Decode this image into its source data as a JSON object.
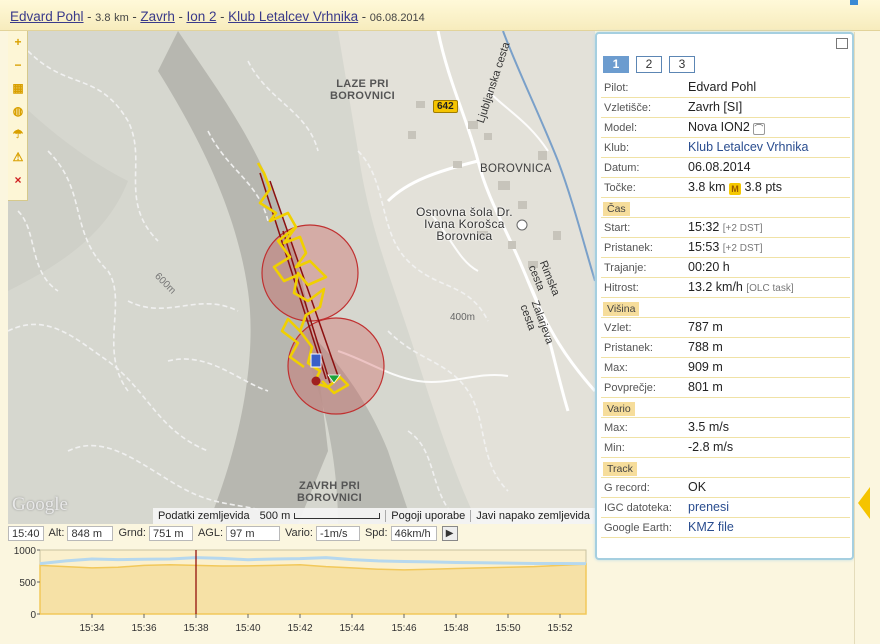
{
  "header": {
    "pilot": "Edvard Pohl",
    "distance": "3.8",
    "distance_unit": "km",
    "site": "Zavrh",
    "glider": "Ion 2",
    "club": "Klub Letalcev Vrhnika",
    "date": "06.08.2014",
    "separator": "-"
  },
  "map": {
    "toolbar": [
      {
        "icon": "zoom-in-icon",
        "glyph": "+"
      },
      {
        "icon": "zoom-out-icon",
        "glyph": "−"
      },
      {
        "icon": "map-type-icon",
        "glyph": "▦"
      },
      {
        "icon": "layers-icon",
        "glyph": "◍"
      },
      {
        "icon": "paraglider-icon",
        "glyph": "☂"
      },
      {
        "icon": "warning-icon",
        "glyph": "⚠"
      },
      {
        "icon": "close-icon",
        "glyph": "×"
      }
    ],
    "labels": {
      "laze": "LAZE PRI\nBOROVNICI",
      "borovnica": "BOROVNICA",
      "school": "Osnovna šola Dr.\nIvana Korošca\nBorovnica",
      "zavrh": "ZAVRH PRI\nBOROVNICI",
      "road_642": "642",
      "ljubljanska": "Ljubljanska cesta",
      "rimska": "Rimska cesta",
      "zalarjeva": "Zalarjeva cesta",
      "contour_400": "400m",
      "contour_600": "600m",
      "google": "Google"
    },
    "footer": {
      "map_data": "Podatki zemljevida",
      "scale": "500 m",
      "terms": "Pogoji uporabe",
      "report": "Javi napako zemljevida"
    }
  },
  "readout": {
    "time": "15:40",
    "alt_label": "Alt:",
    "alt": "848 m",
    "grnd_label": "Grnd:",
    "grnd": "751 m",
    "agl_label": "AGL:",
    "agl": "97 m",
    "vario_label": "Vario:",
    "vario": "-1m/s",
    "spd_label": "Spd:",
    "spd": "46km/h",
    "play_icon": "play-icon"
  },
  "chart_data": {
    "type": "area",
    "title": "",
    "xlabel": "",
    "ylabel": "",
    "ylim": [
      0,
      1000
    ],
    "y_ticks": [
      "1000",
      "500",
      "0"
    ],
    "x_ticks": [
      "15:34",
      "15:36",
      "15:38",
      "15:40",
      "15:42",
      "15:44",
      "15:46",
      "15:48",
      "15:50",
      "15:52"
    ],
    "x": [
      "15:32",
      "15:33",
      "15:34",
      "15:35",
      "15:36",
      "15:37",
      "15:38",
      "15:39",
      "15:40",
      "15:41",
      "15:42",
      "15:43",
      "15:44",
      "15:45",
      "15:46",
      "15:47",
      "15:48",
      "15:49",
      "15:50",
      "15:51",
      "15:52",
      "15:53"
    ],
    "series": [
      {
        "values": [
          787,
          830,
          860,
          850,
          855,
          860,
          880,
          870,
          848,
          860,
          865,
          880,
          850,
          830,
          820,
          815,
          805,
          800,
          795,
          790,
          789,
          788
        ]
      },
      {
        "values": [
          760,
          740,
          720,
          730,
          760,
          770,
          760,
          750,
          751,
          760,
          770,
          740,
          720,
          700,
          690,
          700,
          710,
          720,
          730,
          740,
          760,
          780
        ]
      }
    ],
    "cursor_x": "15:38",
    "colors": {
      "fill": "#f6e1a6",
      "ground": "#f2c85a",
      "track": "#b6d8ee",
      "cursor": "#8b0000"
    }
  },
  "panel": {
    "tabs": [
      "1",
      "2",
      "3"
    ],
    "rows": {
      "pilot": {
        "k": "Pilot:",
        "v": "Edvard Pohl"
      },
      "takeoff": {
        "k": "Vzletišče:",
        "v": "Zavrh [SI]"
      },
      "model": {
        "k": "Model:",
        "v": "Nova ION2"
      },
      "club": {
        "k": "Klub:",
        "v": "Klub Letalcev Vrhnika"
      },
      "date": {
        "k": "Datum:",
        "v": "06.08.2014"
      },
      "points": {
        "k": "Točke:",
        "dist": "3.8 km",
        "pts": "3.8 pts",
        "medal": "M"
      }
    },
    "sec_time": "Čas",
    "time_rows": {
      "start": {
        "k": "Start:",
        "v": "15:32",
        "note": "[+2 DST]"
      },
      "landing": {
        "k": "Pristanek:",
        "v": "15:53",
        "note": "[+2 DST]"
      },
      "duration": {
        "k": "Trajanje:",
        "v": "00:20 h"
      },
      "speed": {
        "k": "Hitrost:",
        "v": "13.2 km/h",
        "note": "[OLC task]"
      }
    },
    "sec_height": "Višina",
    "height_rows": {
      "takeoff": {
        "k": "Vzlet:",
        "v": "787 m"
      },
      "landing": {
        "k": "Pristanek:",
        "v": "788 m"
      },
      "max": {
        "k": "Max:",
        "v": "909 m"
      },
      "avg": {
        "k": "Povprečje:",
        "v": "801 m"
      }
    },
    "sec_vario": "Vario",
    "vario_rows": {
      "max": {
        "k": "Max:",
        "v": "3.5 m/s"
      },
      "min": {
        "k": "Min:",
        "v": "-2.8 m/s"
      }
    },
    "sec_track": "Track",
    "track_rows": {
      "grecord": {
        "k": "G record:",
        "v": "OK"
      },
      "igc": {
        "k": "IGC datoteka:",
        "v": "prenesi"
      },
      "earth": {
        "k": "Google Earth:",
        "v": "KMZ file"
      }
    }
  }
}
